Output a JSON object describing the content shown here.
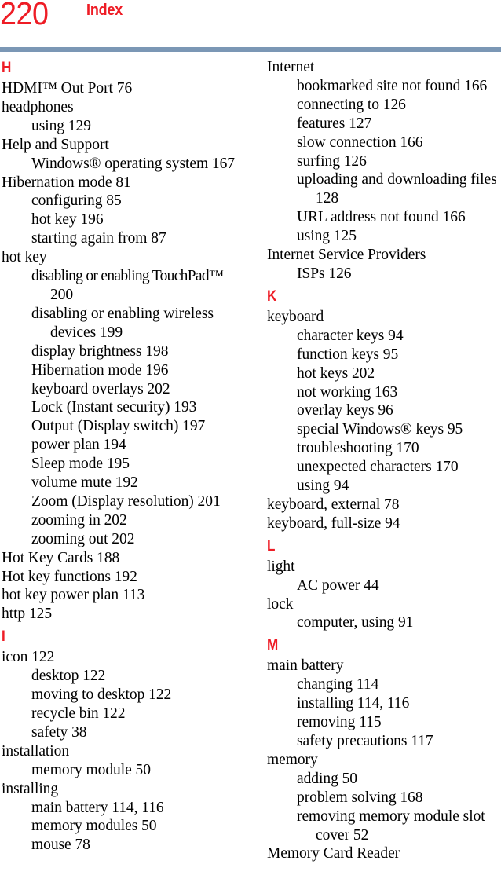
{
  "header": {
    "folio": "220",
    "running_head": "Index",
    "rule_color": "#7b97b5",
    "accent_color": "#ee1c25"
  },
  "columns": [
    {
      "name": "left-column",
      "blocks": [
        {
          "letter": "H",
          "entries": [
            {
              "level": 0,
              "text": "HDMI™ Out Port 76"
            },
            {
              "level": 0,
              "text": "headphones"
            },
            {
              "level": 1,
              "text": "using 129"
            },
            {
              "level": 0,
              "text": "Help and Support"
            },
            {
              "level": 1,
              "text": "Windows® operating system 167"
            },
            {
              "level": 0,
              "text": "Hibernation mode 81"
            },
            {
              "level": 1,
              "text": "configuring 85"
            },
            {
              "level": 1,
              "text": "hot key 196"
            },
            {
              "level": 1,
              "text": "starting again from 87"
            },
            {
              "level": 0,
              "text": "hot key"
            },
            {
              "level": 1,
              "text": "disabling or enabling TouchPad™",
              "tight": true
            },
            {
              "level": 2,
              "text": "200"
            },
            {
              "level": 1,
              "text": "disabling or enabling wireless"
            },
            {
              "level": 2,
              "text": "devices 199"
            },
            {
              "level": 1,
              "text": "display brightness 198"
            },
            {
              "level": 1,
              "text": "Hibernation mode 196"
            },
            {
              "level": 1,
              "text": "keyboard overlays 202"
            },
            {
              "level": 1,
              "text": "Lock (Instant security) 193"
            },
            {
              "level": 1,
              "text": "Output (Display switch) 197"
            },
            {
              "level": 1,
              "text": "power plan 194"
            },
            {
              "level": 1,
              "text": "Sleep mode 195"
            },
            {
              "level": 1,
              "text": "volume mute 192"
            },
            {
              "level": 1,
              "text": "Zoom (Display resolution) 201"
            },
            {
              "level": 1,
              "text": "zooming in 202"
            },
            {
              "level": 1,
              "text": "zooming out 202"
            },
            {
              "level": 0,
              "text": "Hot Key Cards 188"
            },
            {
              "level": 0,
              "text": "Hot key functions 192"
            },
            {
              "level": 0,
              "text": "hot key power plan 113"
            },
            {
              "level": 0,
              "text": "http 125"
            }
          ]
        },
        {
          "letter": "I",
          "entries": [
            {
              "level": 0,
              "text": "icon 122"
            },
            {
              "level": 1,
              "text": "desktop 122"
            },
            {
              "level": 1,
              "text": "moving to desktop 122"
            },
            {
              "level": 1,
              "text": "recycle bin 122"
            },
            {
              "level": 1,
              "text": "safety 38"
            },
            {
              "level": 0,
              "text": "installation"
            },
            {
              "level": 1,
              "text": "memory module 50"
            },
            {
              "level": 0,
              "text": "installing"
            },
            {
              "level": 1,
              "text": "main battery 114, 116"
            },
            {
              "level": 1,
              "text": "memory modules 50"
            },
            {
              "level": 1,
              "text": "mouse 78"
            }
          ]
        }
      ]
    },
    {
      "name": "right-column",
      "blocks": [
        {
          "letter": null,
          "entries": [
            {
              "level": 0,
              "text": "Internet"
            },
            {
              "level": 1,
              "text": "bookmarked site not found 166"
            },
            {
              "level": 1,
              "text": "connecting to 126"
            },
            {
              "level": 1,
              "text": "features 127"
            },
            {
              "level": 1,
              "text": "slow connection 166"
            },
            {
              "level": 1,
              "text": "surfing 126"
            },
            {
              "level": 1,
              "text": "uploading and downloading files"
            },
            {
              "level": 2,
              "text": "128"
            },
            {
              "level": 1,
              "text": "URL address not found 166"
            },
            {
              "level": 1,
              "text": "using 125"
            },
            {
              "level": 0,
              "text": "Internet Service Providers"
            },
            {
              "level": 1,
              "text": "ISPs 126"
            }
          ]
        },
        {
          "letter": "K",
          "entries": [
            {
              "level": 0,
              "text": "keyboard"
            },
            {
              "level": 1,
              "text": "character keys 94"
            },
            {
              "level": 1,
              "text": "function keys 95"
            },
            {
              "level": 1,
              "text": "hot keys 202"
            },
            {
              "level": 1,
              "text": "not working 163"
            },
            {
              "level": 1,
              "text": "overlay keys 96"
            },
            {
              "level": 1,
              "text": "special Windows® keys 95"
            },
            {
              "level": 1,
              "text": "troubleshooting 170"
            },
            {
              "level": 1,
              "text": "unexpected characters 170"
            },
            {
              "level": 1,
              "text": "using 94"
            },
            {
              "level": 0,
              "text": "keyboard, external 78"
            },
            {
              "level": 0,
              "text": "keyboard, full-size 94"
            }
          ]
        },
        {
          "letter": "L",
          "entries": [
            {
              "level": 0,
              "text": "light"
            },
            {
              "level": 1,
              "text": "AC power 44"
            },
            {
              "level": 0,
              "text": "lock"
            },
            {
              "level": 1,
              "text": "computer, using 91"
            }
          ]
        },
        {
          "letter": "M",
          "entries": [
            {
              "level": 0,
              "text": "main battery"
            },
            {
              "level": 1,
              "text": "changing 114"
            },
            {
              "level": 1,
              "text": "installing 114, 116"
            },
            {
              "level": 1,
              "text": "removing 115"
            },
            {
              "level": 1,
              "text": "safety precautions 117"
            },
            {
              "level": 0,
              "text": "memory"
            },
            {
              "level": 1,
              "text": "adding 50"
            },
            {
              "level": 1,
              "text": "problem solving 168"
            },
            {
              "level": 1,
              "text": "removing memory module slot"
            },
            {
              "level": 2,
              "text": "cover 52"
            },
            {
              "level": 0,
              "text": "Memory Card Reader"
            }
          ]
        }
      ]
    }
  ]
}
